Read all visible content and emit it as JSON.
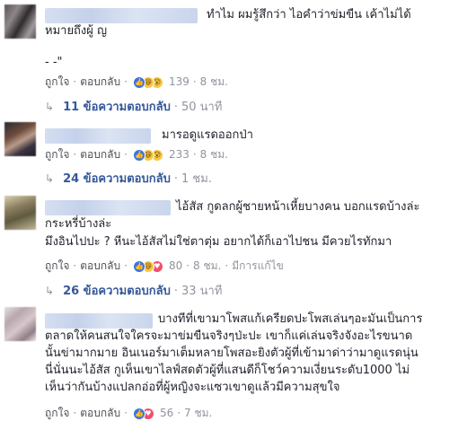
{
  "comments": [
    {
      "lines": [
        "ทำไม ผมรู้สึกว่า ไอคำว่าข่มขืน เค้าไม่ได้",
        "หมายถึงผู้ ญ",
        "",
        "- -\""
      ],
      "like_label": "ถูกใจ",
      "reply_label": "ตอบกลับ",
      "reaction_count": "139",
      "time": "8 ชม.",
      "edited": "",
      "replies_text": "11 ข้อความตอบกลับ",
      "replies_time": "50 นาที"
    },
    {
      "lines": [
        "มารอดูแรดออกป่า"
      ],
      "like_label": "ถูกใจ",
      "reply_label": "ตอบกลับ",
      "reaction_count": "233",
      "time": "8 ชม.",
      "edited": "",
      "replies_text": "24 ข้อความตอบกลับ",
      "replies_time": "1 ชม."
    },
    {
      "lines": [
        "ไอ้สัส กูดลกผู้ชายหน้าเหี้ยบางคน บอกแรดบ้างล่ะ",
        "กระหรี่บ้างล่ะ",
        "มึงอินไปปะ ? หีนะไอ้สัสไม่ใช่ตาตุ่ม อยากได้ก็เอาไปชน มีควยไรทักมา"
      ],
      "like_label": "ถูกใจ",
      "reply_label": "ตอบกลับ",
      "reaction_count": "80",
      "time": "8 ชม.",
      "edited": "มีการแก้ไข",
      "replies_text": "26 ข้อความตอบกลับ",
      "replies_time": "33 นาที"
    },
    {
      "lines": [
        "บางทีที่เขามาโพสแก้เครียดปะโพสเล่นๆอะมันเป็นการ",
        "ตลาดให้คนสนใจใครจะมาข่มขืนจริงๆป่ะปะ เขาก็แค่เล่นจริงจังอะไรขนาด",
        "นั้นข่ามากมาย อินเนอร์มาเต็มหลายโพสอะยิงตัวผู้ที่เข้ามาด่าว่ามาดูแรดนุ่น",
        "นี่นั่นนะไอ้สัส กูเห็นเขาไลฟ์สดตัวผู้ที่แสนดีก็โชว์ความเงี่ยนระดับ1000 ไม่",
        "เห็นว่ากันบ้างแปลกอ่อที่ผู้หญิงจะแซวเขาดูแล้วมีความสุขใจ"
      ],
      "like_label": "ถูกใจ",
      "reply_label": "ตอบกลับ",
      "reaction_count": "56",
      "time": "7 ชม.",
      "edited": "",
      "replies_text": "",
      "replies_time": ""
    }
  ],
  "reaction_icons": {
    "like": "👍",
    "haha": "😆",
    "wow": "😮",
    "love": "♥"
  },
  "dot_separator": "·",
  "reply_arrow": "↳",
  "colors": {
    "link": "#365899",
    "meta": "#90949c",
    "text": "#1d2129",
    "like_blue": "#3b73e8"
  }
}
